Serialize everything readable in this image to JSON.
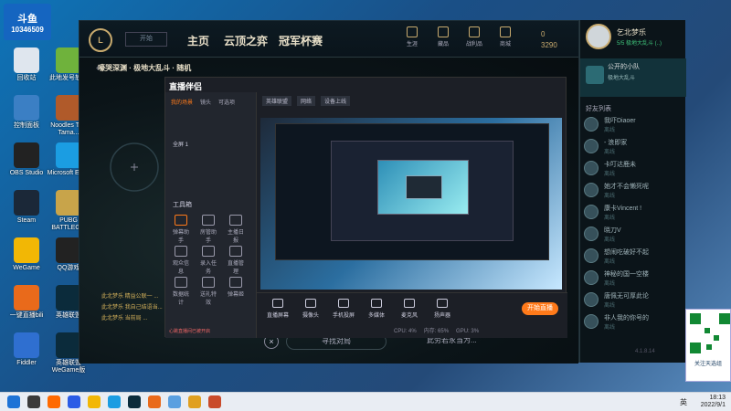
{
  "overlay": {
    "logo": "斗鱼",
    "room_id": "10346509"
  },
  "desktop_icons": [
    {
      "label": "回收站",
      "color": "#dfe6ee"
    },
    {
      "label": "此地发号软件",
      "color": "#6fb23c"
    },
    {
      "label": "控制面板",
      "color": "#3b7fc4"
    },
    {
      "label": "Noodles The Tama...",
      "color": "#b05a2a"
    },
    {
      "label": "OBS Studio",
      "color": "#222"
    },
    {
      "label": "Microsoft Edge",
      "color": "#1b9de2"
    },
    {
      "label": "Steam",
      "color": "#1b2838"
    },
    {
      "label": "PUBG BATTLEG...",
      "color": "#c8a44a"
    },
    {
      "label": "WeGame",
      "color": "#f2b705"
    },
    {
      "label": "QQ游戏",
      "color": "#222"
    },
    {
      "label": "一键直播bili",
      "color": "#e96a1b"
    },
    {
      "label": "英雄联盟",
      "color": "#0b2b3b"
    },
    {
      "label": "Fiddler",
      "color": "#2f6fd0"
    },
    {
      "label": "英雄联盟WeGame版",
      "color": "#0b2b3b"
    }
  ],
  "lol": {
    "nav": [
      "主页",
      "云顶之弈",
      "冠军杯赛"
    ],
    "icons": [
      "生涯",
      "藏品",
      "战利品",
      "商城"
    ],
    "currency": {
      "rp": "0",
      "be": "3290"
    },
    "mode": "嚎哭深渊 · 极地大乱斗 · 随机",
    "find_match": "寻找对局",
    "chat_lines": [
      "此北梦乐 精益公联一 ...",
      "此北梦乐 我自己结语当...",
      "此北梦乐 当前局 ..."
    ],
    "chat_input": "此劳若永当为..."
  },
  "friends": {
    "profile_name": "乞北梦乐",
    "profile_status": "5/5 极地大乱斗 (..)",
    "group": "公开的小队",
    "group_sub": "极地大乱斗",
    "list_title": "好友列表",
    "items": [
      {
        "name": "我吓Diaoer",
        "status": "离线"
      },
      {
        "name": "- 浪即家",
        "status": "离线"
      },
      {
        "name": "卡叮达鹿未",
        "status": "离线"
      },
      {
        "name": "她才不会懒死呢",
        "status": "离线"
      },
      {
        "name": "康卡Vincent !",
        "status": "离线"
      },
      {
        "name": "晓刀V",
        "status": "离线"
      },
      {
        "name": "想闹吃破好不起",
        "status": "离线"
      },
      {
        "name": "神秘的国一空楼",
        "status": "离线"
      },
      {
        "name": "唐佩无可厚此论",
        "status": "离线"
      },
      {
        "name": "非人我的你号的",
        "status": "离线"
      }
    ],
    "version": "4.1.8.14"
  },
  "streamer": {
    "title": "直播伴侣",
    "tabs": [
      "我的场景",
      "镜头",
      "可选项"
    ],
    "scene": "全屏 1",
    "toolbox": "工具箱",
    "tools": [
      "弹幕助手",
      "房管助手",
      "主播日报",
      "观众信息",
      "录入任务",
      "直播管理",
      "数据统计",
      "送礼特效",
      "弹幕姬"
    ],
    "header_fields": [
      "英雄联盟",
      "网络",
      "设备上线"
    ],
    "bottom_tools": [
      "直播屏幕",
      "摄像头",
      "手机投屏",
      "多媒体",
      "麦克风",
      "扬声器"
    ],
    "start_button": "开始直播",
    "status": [
      "CPU: 4%",
      "内存: 65%",
      "GPU: 3%"
    ],
    "notice": "心跳直播间已被开启"
  },
  "ad": {
    "caption": "关注天选组"
  },
  "clock": {
    "time": "18:13",
    "date": "2022/9/1"
  },
  "ime": "英"
}
